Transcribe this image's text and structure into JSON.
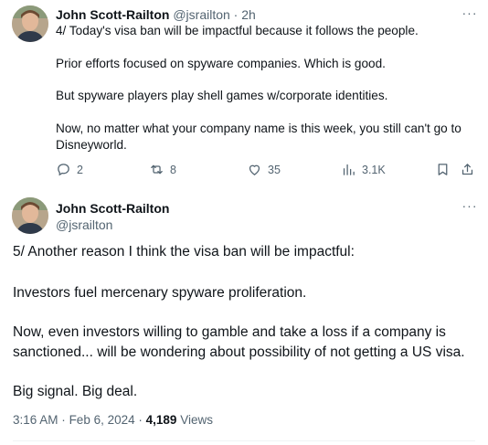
{
  "tweet1": {
    "author_name": "John Scott-Railton",
    "author_handle": "@jsrailton",
    "separator": "·",
    "time": "2h",
    "paragraphs": [
      "4/ Today's visa ban will be impactful because it follows the people.",
      "Prior efforts focused on spyware companies. Which is good.",
      "But spyware players play shell games w/corporate identities.",
      "Now, no matter what your company name is this week, you still can't go to",
      "Disneyworld."
    ],
    "replies": "2",
    "reposts": "8",
    "likes": "35",
    "views": "3.1K",
    "more_label": "···"
  },
  "tweet2": {
    "author_name": "John Scott-Railton",
    "author_handle": "@jsrailton",
    "more_label": "···",
    "paragraphs": [
      "5/ Another reason I think the visa ban will be impactful:",
      "Investors fuel mercenary spyware proliferation.",
      "Now, even investors willing to gamble and take a loss if a company is",
      "sanctioned... will be wondering about possibility of not getting a US visa.",
      "Big signal. Big deal."
    ],
    "time": "3:16 AM",
    "dot1": "·",
    "date": "Feb 6, 2024",
    "dot2": "·",
    "views_count": "4,189",
    "views_label": "Views"
  },
  "colors": {
    "text_primary": "#0f1419",
    "text_secondary": "#536471",
    "divider": "#eff3f4"
  },
  "icons": [
    "reply-icon",
    "repost-icon",
    "like-icon",
    "views-icon",
    "bookmark-icon",
    "share-icon",
    "more-icon"
  ]
}
